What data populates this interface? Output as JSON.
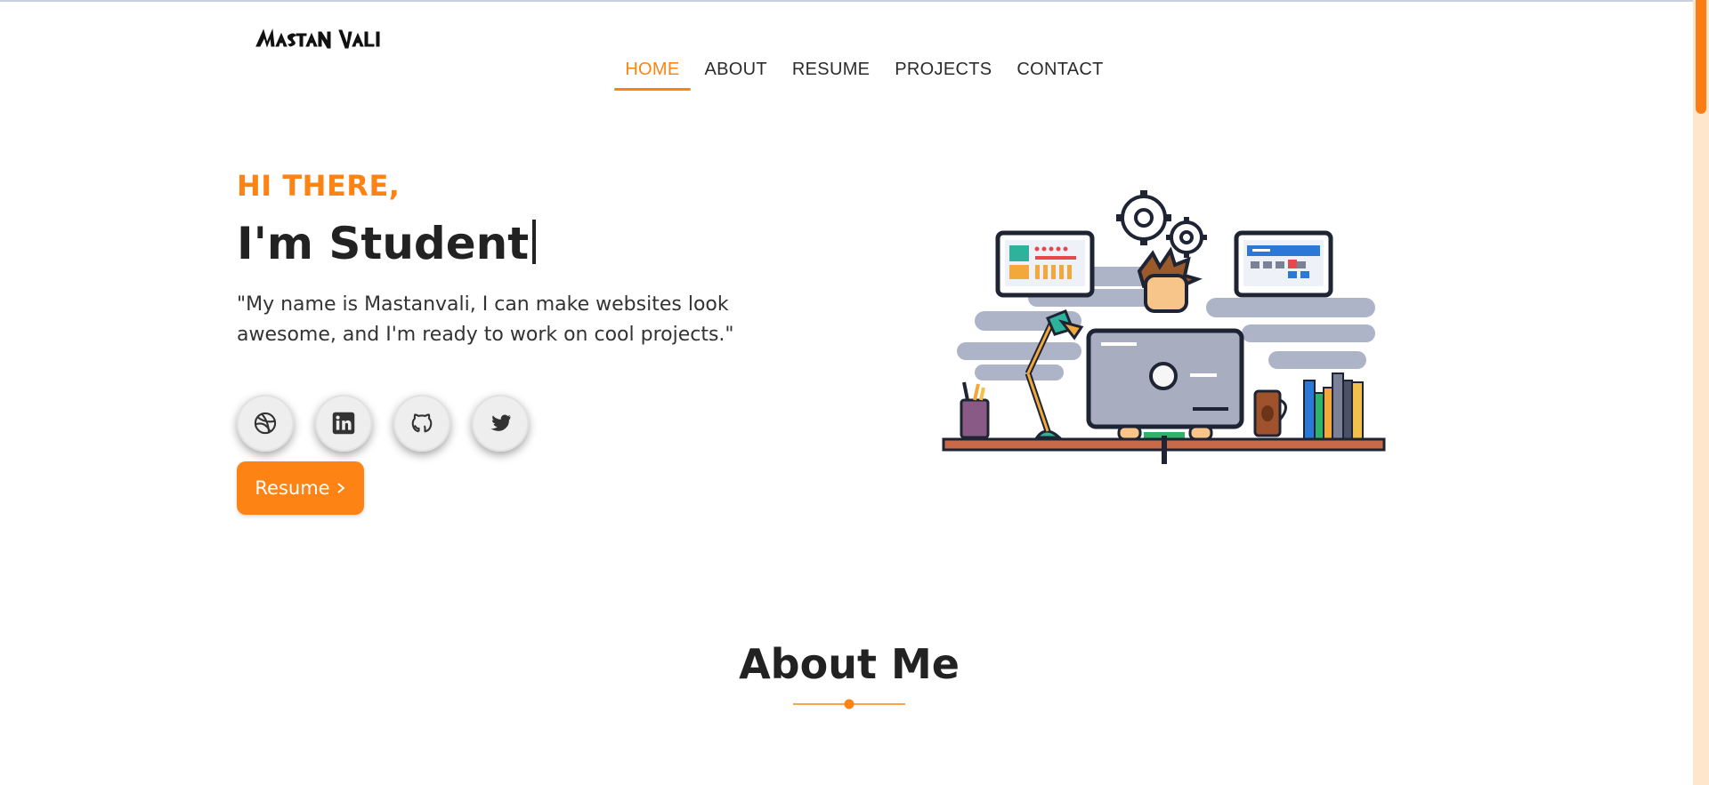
{
  "header": {
    "logo_text": "MASTAN VALI",
    "nav": [
      {
        "label": "HOME",
        "active": true
      },
      {
        "label": "ABOUT",
        "active": false
      },
      {
        "label": "RESUME",
        "active": false
      },
      {
        "label": "PROJECTS",
        "active": false
      },
      {
        "label": "CONTACT",
        "active": false
      }
    ]
  },
  "hero": {
    "kicker": "HI THERE,",
    "title": "I'm Student",
    "description": "\"My name is Mastanvali, I can make websites look awesome, and I'm ready to work on cool projects.\"",
    "socials": [
      {
        "icon": "dribbble-icon"
      },
      {
        "icon": "linkedin-icon"
      },
      {
        "icon": "github-icon"
      },
      {
        "icon": "twitter-icon"
      }
    ],
    "resume_button": "Resume",
    "resume_icon": "chevron-right-icon"
  },
  "about": {
    "title": "About Me"
  },
  "colors": {
    "accent": "#fd8414",
    "text": "#222222",
    "scrollbar_track": "#fde6cc"
  }
}
